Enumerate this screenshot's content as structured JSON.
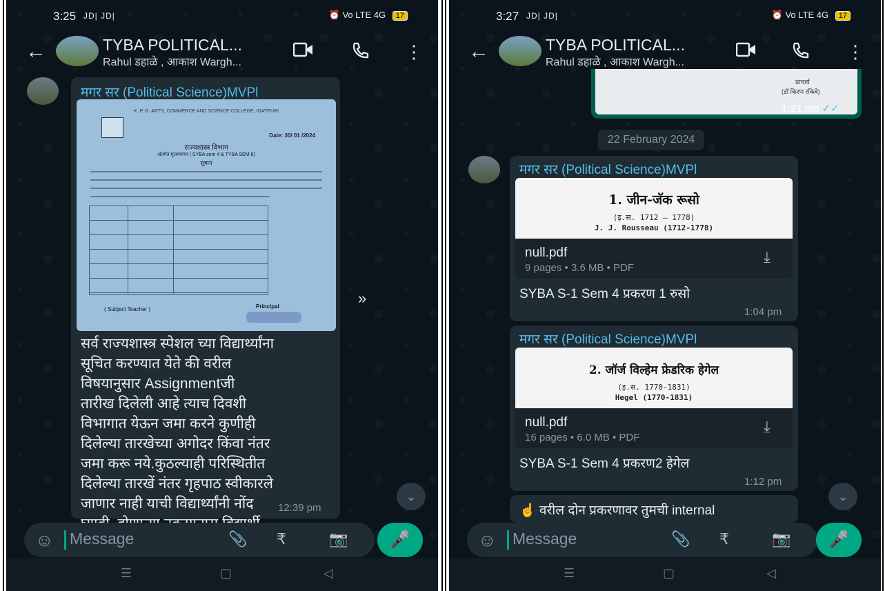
{
  "left": {
    "status": {
      "time": "3:25",
      "carrier": "JD| JD|",
      "volte": "Vo LTE",
      "network": "4G",
      "battery": "17"
    },
    "header": {
      "title": "TYBA POLITICAL...",
      "subtitle": "Rahul डहाळे , आकाश Wargh..."
    },
    "message": {
      "sender": "मगर सर (Political Science)MVPl",
      "doc": {
        "college": "K. P. G. ARTS, COMMERCE AND SCIENCE COLLEGE, IGATPURI",
        "date": "Date: 30/ 01 /2024",
        "heading": "राज्यशास्त्र विभाग",
        "subheading": "अंतर्गत मूल्यमापन ( SYBA sem 4 & TYBA SEM 6)",
        "notice": "सूचना",
        "sign_left": "( Subject Teacher )",
        "sign_right": "Principal"
      },
      "text": "सर्व राज्यशास्त्र स्पेशल च्या विद्यार्थ्यांना\nसूचित करण्यात येते की वरील\nविषयानुसार Assignmentजी\nतारीख दिलेली आहे त्याच दिवशी\nविभागात येऊन जमा करने कुणीही\nदिलेल्या तारखेच्या अगोदर किंवा नंतर\nजमा करू नये.कुठल्याही परिस्थितीत\nदिलेल्या तारखें नंतर गृहपाठ स्वीकारले\nजाणार नाही याची विद्यार्थ्यांनी नोंद\nघ्यावी. होणाऱ्या नुकसानास विद्यार्थी\nस्वतः जबाबदार असेल",
      "time": "12:39 pm"
    },
    "input": {
      "placeholder": "Message"
    }
  },
  "right": {
    "status": {
      "time": "3:27",
      "carrier": "JD| JD|",
      "volte": "Vo LTE",
      "network": "4G",
      "battery": "17"
    },
    "header": {
      "title": "TYBA POLITICAL...",
      "subtitle": "Rahul डहाळे , आकाश Wargh..."
    },
    "prev": {
      "stamp": "प्राचार्य",
      "name": "(डॉ किरण रकिबे)",
      "time": "1:21 pm"
    },
    "date_chip": "22 February 2024",
    "messages": [
      {
        "sender": "मगर सर (Political Science)MVPl",
        "preview_title": "1. जीन-जॅक रूसो",
        "preview_sub1": "(इ.स. 1712 – 1778)",
        "preview_sub2": "J. J. Rousseau (1712-1778)",
        "file": "null.pdf",
        "meta": "9 pages • 3.6 MB • PDF",
        "caption": "SYBA S-1 Sem 4  प्रकरण 1 रुसो",
        "time": "1:04 pm"
      },
      {
        "sender": "मगर सर (Political Science)MVPl",
        "preview_title": "2. जॉर्ज विल्हेम फ्रेडरिक हेगेल",
        "preview_sub1": "(इ.स. 1770-1831)",
        "preview_sub2": "Hegel (1770-1831)",
        "file": "null.pdf",
        "meta": "16 pages • 6.0 MB • PDF",
        "caption": "SYBA S-1 Sem 4 प्रकरण2 हेगेल",
        "time": "1:12 pm"
      }
    ],
    "partial_text": "☝️ वरील दोन प्रकरणावर तुमची internal",
    "input": {
      "placeholder": "Message"
    }
  }
}
